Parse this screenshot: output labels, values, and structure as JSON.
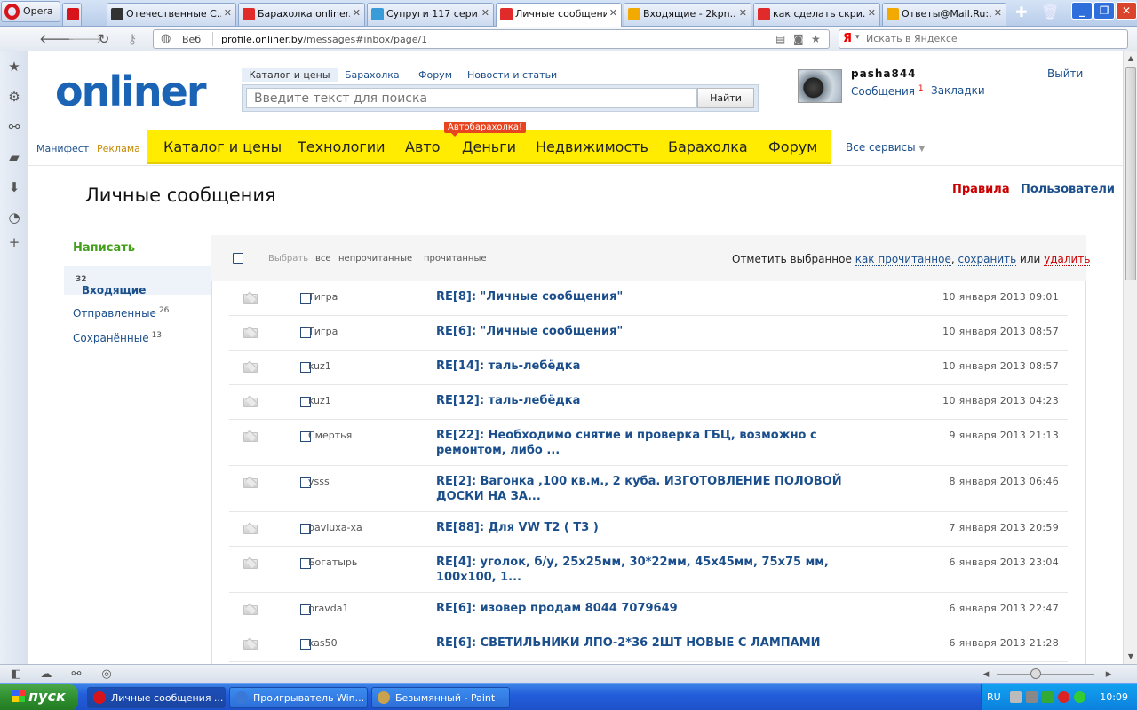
{
  "browser": {
    "menu_label": "Opera",
    "tabs": [
      {
        "title": "",
        "favicon_color": "#d8141b",
        "active": false
      },
      {
        "title": "Отечественные С...",
        "favicon_color": "#333333",
        "active": false
      },
      {
        "title": "Барахолка onliner...",
        "favicon_color": "#e12a2a",
        "active": false
      },
      {
        "title": "Супруги 117 сери...",
        "favicon_color": "#3a9bd9",
        "active": false
      },
      {
        "title": "Личные сообщения",
        "favicon_color": "#e12a2a",
        "active": true
      },
      {
        "title": "Входящие - 2kpn...",
        "favicon_color": "#f2a900",
        "active": false
      },
      {
        "title": "как сделать скри...",
        "favicon_color": "#e12a2a",
        "active": false
      },
      {
        "title": "Ответы@Mail.Ru:...",
        "favicon_color": "#f2a900",
        "active": false
      }
    ],
    "address": {
      "mode": "Веб",
      "host": "profile.onliner.by",
      "path": "/messages#inbox/page/1"
    },
    "search_placeholder": "Искать в Яндексе",
    "search_engine_label": "Я"
  },
  "site": {
    "logo": "onliner",
    "search_tabs": [
      "Каталог и цены",
      "Барахолка",
      "Форум",
      "Новости и статьи"
    ],
    "search_placeholder": "Введите текст для поиска",
    "search_button": "Найти",
    "user": {
      "name": "pasha844",
      "messages_label": "Сообщения",
      "messages_count": "1",
      "bookmarks_label": "Закладки",
      "logout_label": "Выйти"
    },
    "mini_links": [
      "Манифест",
      "Реклама"
    ],
    "nav": [
      "Каталог и цены",
      "Технологии",
      "Авто",
      "Деньги",
      "Недвижимость",
      "Барахолка",
      "Форум"
    ],
    "auto_badge": "Автобарахолка!",
    "all_services": "Все сервисы"
  },
  "messages_page": {
    "title": "Личные сообщения",
    "rules_link": "Правила",
    "users_link": "Пользователи",
    "write_label": "Написать",
    "folders": [
      {
        "label": "Входящие",
        "count": "32"
      },
      {
        "label": "Отправленные",
        "count": "26"
      },
      {
        "label": "Сохранённые",
        "count": "13"
      }
    ],
    "select_label": "Выбрать",
    "select_options": [
      "все",
      "непрочитанные",
      "прочитанные"
    ],
    "mark_label": "Отметить выбранное",
    "mark_read": "как прочитанное",
    "save_label": "сохранить",
    "or_label": "или",
    "delete_label": "удалить",
    "messages": [
      {
        "from": "Тигра",
        "subject": "RE[8]: \"Личные сообщения\"",
        "date": "10 января 2013",
        "time": "09:01"
      },
      {
        "from": "Тигра",
        "subject": "RE[6]: \"Личные сообщения\"",
        "date": "10 января 2013",
        "time": "08:57"
      },
      {
        "from": "kuz1",
        "subject": "RE[14]: таль-лебёдка",
        "date": "10 января 2013",
        "time": "08:57"
      },
      {
        "from": "kuz1",
        "subject": "RE[12]: таль-лебёдка",
        "date": "10 января 2013",
        "time": "04:23"
      },
      {
        "from": "Смертья",
        "subject": "RE[22]: Необходимо снятие и проверка ГБЦ, возможно с ремонтом, либо ...",
        "date": "9 января 2013",
        "time": "21:13"
      },
      {
        "from": "ysss",
        "subject": "RE[2]: Вагонка ,100 кв.м., 2 куба. ИЗГОТОВЛЕНИЕ ПОЛОВОЙ ДОСКИ НА ЗА...",
        "date": "8 января 2013",
        "time": "06:46"
      },
      {
        "from": "pavluxa-xa",
        "subject": "RE[88]: Для VW T2 ( T3 )",
        "date": "7 января 2013",
        "time": "20:59"
      },
      {
        "from": "Богатырь",
        "subject": "RE[4]: уголок, б/у, 25x25мм, 30*22мм, 45x45мм, 75x75 мм, 100x100, 1...",
        "date": "6 января 2013",
        "time": "23:04"
      },
      {
        "from": "pravda1",
        "subject": "RE[6]: изовер продам 8044 7079649",
        "date": "6 января 2013",
        "time": "22:47"
      },
      {
        "from": "kas50",
        "subject": "RE[6]: СВЕТИЛЬНИКИ ЛПО-2*36 2ШТ НОВЫЕ С ЛАМПАМИ",
        "date": "6 января 2013",
        "time": "21:28"
      }
    ]
  },
  "taskbar": {
    "start_label": "пуск",
    "buttons": [
      {
        "label": "Личные сообщения ...",
        "icon_color": "#d8141b",
        "active": true
      },
      {
        "label": "Проигрыватель Win...",
        "icon_color": "#3a78d8",
        "active": false
      },
      {
        "label": "Безымянный - Paint",
        "icon_color": "#c9a24c",
        "active": false
      }
    ],
    "language": "RU",
    "clock": "10:09"
  }
}
